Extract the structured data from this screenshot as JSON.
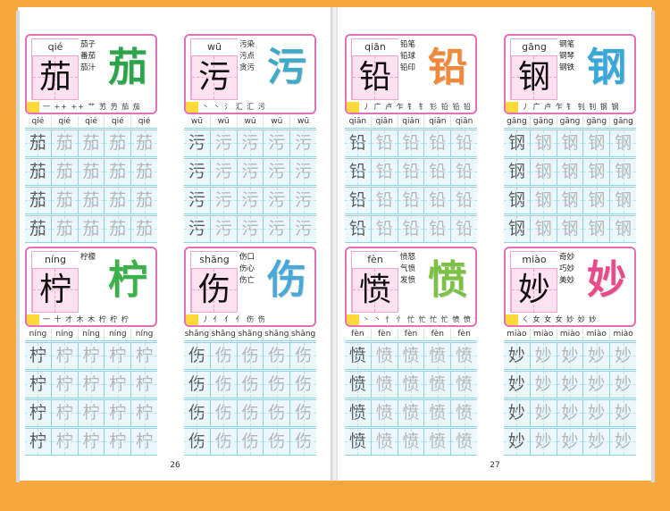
{
  "pages": [
    {
      "number": "26",
      "entries": [
        {
          "char": "茄",
          "pinyin": "qié",
          "words": [
            "茄子",
            "番茄",
            "茄汁"
          ],
          "strokes": "一 ++ ++ 艹 艻 芀 茄 茄",
          "art_color": "#2aa54a"
        },
        {
          "char": "污",
          "pinyin": "wū",
          "words": [
            "污染",
            "污点",
            "贪污"
          ],
          "strokes": "丶 丶 氵 汇 汇 污",
          "art_color": "#3fa9c9"
        },
        {
          "char": "柠",
          "pinyin": "níng",
          "words": [
            "柠檬"
          ],
          "strokes": "一 十 才 木 木 柠 柠 柠",
          "art_color": "#3bb14a"
        },
        {
          "char": "伤",
          "pinyin": "shāng",
          "words": [
            "伤口",
            "伤心",
            "伤亡"
          ],
          "strokes": "丿 亻 亻 亻 伤 伤",
          "art_color": "#4aa8d8"
        }
      ]
    },
    {
      "number": "27",
      "entries": [
        {
          "char": "铅",
          "pinyin": "qiān",
          "words": [
            "铅笔",
            "铅球",
            "铅印"
          ],
          "strokes": "丿 广 卢 乍 钅 钅 钐 铅 铅 铅",
          "art_color": "#f08a3a"
        },
        {
          "char": "钢",
          "pinyin": "gāng",
          "words": [
            "钢笔",
            "钢琴",
            "钢铁"
          ],
          "strokes": "丿 广 卢 乍 钅 钊 钊 钢 钢",
          "art_color": "#38a8d8"
        },
        {
          "char": "愤",
          "pinyin": "fèn",
          "words": [
            "愤怒",
            "气愤",
            "发愤"
          ],
          "strokes": "丶 丶 忄 忄 忙 忙 忙 忙 愤 愤 愤 愤",
          "art_color": "#7cc242"
        },
        {
          "char": "妙",
          "pinyin": "miào",
          "words": [
            "奇妙",
            "巧妙",
            "美妙"
          ],
          "strokes": "ㄑ 女 女 女 妙 妙 妙",
          "art_color": "#e94a8a"
        }
      ]
    }
  ]
}
